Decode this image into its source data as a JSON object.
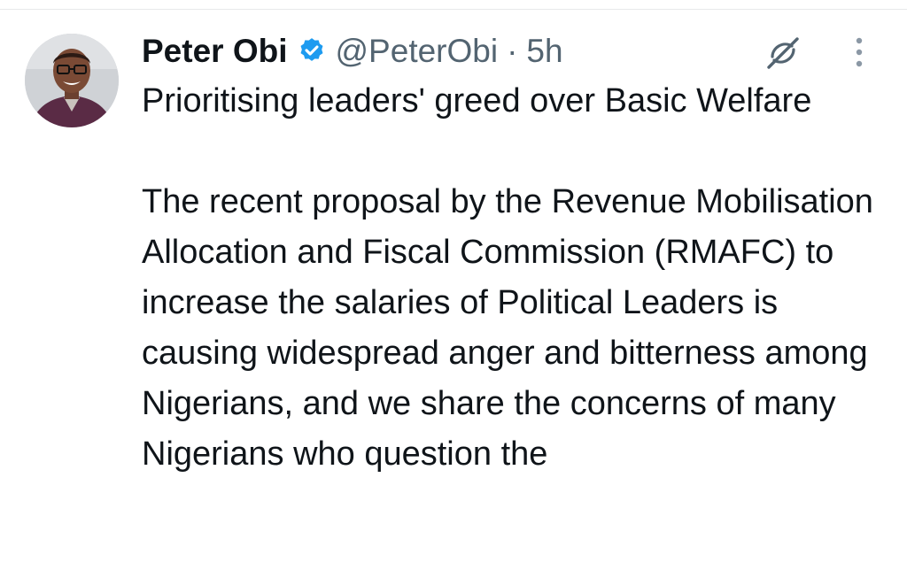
{
  "tweet": {
    "author_name": "Peter Obi",
    "handle": "@PeterObi",
    "separator": "·",
    "time": "5h",
    "verified": true,
    "title": "Prioritising leaders' greed over Basic Welfare",
    "text": "The recent proposal by the Revenue Mobilisation Allocation and Fiscal Commission (RMAFC) to increase the salaries of Political Leaders is causing widespread anger and bitterness among Nigerians, and we share the concerns of many Nigerians who question the"
  },
  "icons": {
    "verified": "verified-badge-icon",
    "grok": "grok-icon",
    "more": "more-options-icon"
  },
  "colors": {
    "text": "#0f1419",
    "secondary": "#536471",
    "verified_blue": "#1d9bf0",
    "divider": "#e7e9ea"
  }
}
